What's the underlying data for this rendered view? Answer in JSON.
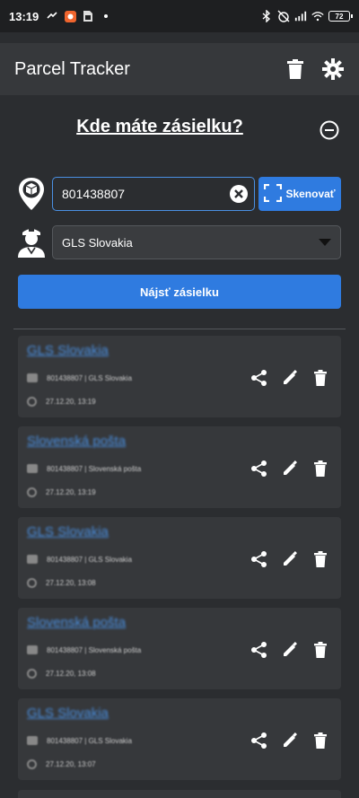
{
  "status_bar": {
    "time": "13:19",
    "battery": "72"
  },
  "app_bar": {
    "title": "Parcel Tracker",
    "delete_icon": "trash-icon",
    "settings_icon": "gear-icon"
  },
  "search": {
    "heading": "Kde máte zásielku?",
    "code_value": "801438807",
    "scan_label": "Skenovať",
    "carrier_selected": "GLS Slovakia",
    "find_label": "Nájsť zásielku"
  },
  "colors": {
    "accent": "#2f7be0",
    "link": "#4a90e2",
    "background": "#2b2d30",
    "card": "#36383b"
  },
  "history": [
    {
      "carrier": "GLS Slovakia",
      "detail": "801438807 | GLS Slovakia",
      "time": "27.12.20, 13:19"
    },
    {
      "carrier": "Slovenská pošta",
      "detail": "801438807 | Slovenská pošta",
      "time": "27.12.20, 13:19"
    },
    {
      "carrier": "GLS Slovakia",
      "detail": "801438807 | GLS Slovakia",
      "time": "27.12.20, 13:08"
    },
    {
      "carrier": "Slovenská pošta",
      "detail": "801438807 | Slovenská pošta",
      "time": "27.12.20, 13:08"
    },
    {
      "carrier": "GLS Slovakia",
      "detail": "801438807 | GLS Slovakia",
      "time": "27.12.20, 13:07"
    }
  ]
}
